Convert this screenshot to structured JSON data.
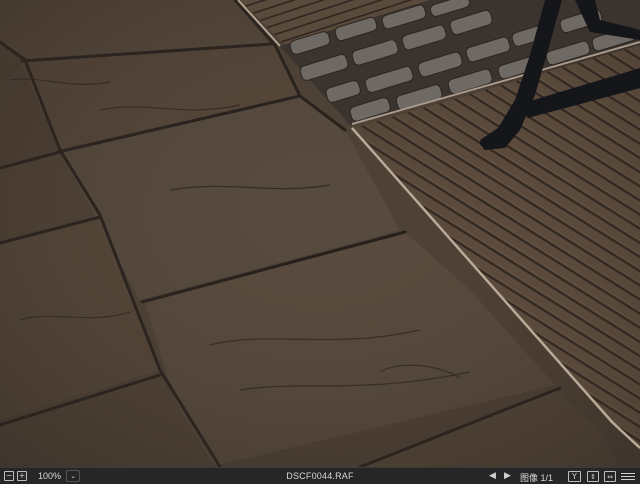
{
  "viewer": {
    "zoom_out_glyph": "−",
    "zoom_in_glyph": "+",
    "zoom_level": "100%",
    "zoom_dropdown_glyph": "⌄",
    "filename": "DSCF0044.RAF",
    "prev_glyph": "◀",
    "next_glyph": "▶",
    "page_label": "图像 1/1",
    "y_icon_label": "Y",
    "split_icon_glyph": "⇕",
    "compare_icon_glyph": "⇔"
  },
  "icons": {
    "zoom_out": "zoom-out-icon",
    "zoom_in": "zoom-in-icon",
    "menu": "hamburger-menu-icon"
  },
  "colors": {
    "statusbar_bg": "#262626",
    "flagstone": "#4f4237",
    "decking": "#5a4a3b",
    "cobble": "#6b6660",
    "metal_trim": "#b9aa98",
    "bench_iron": "#15161a"
  }
}
